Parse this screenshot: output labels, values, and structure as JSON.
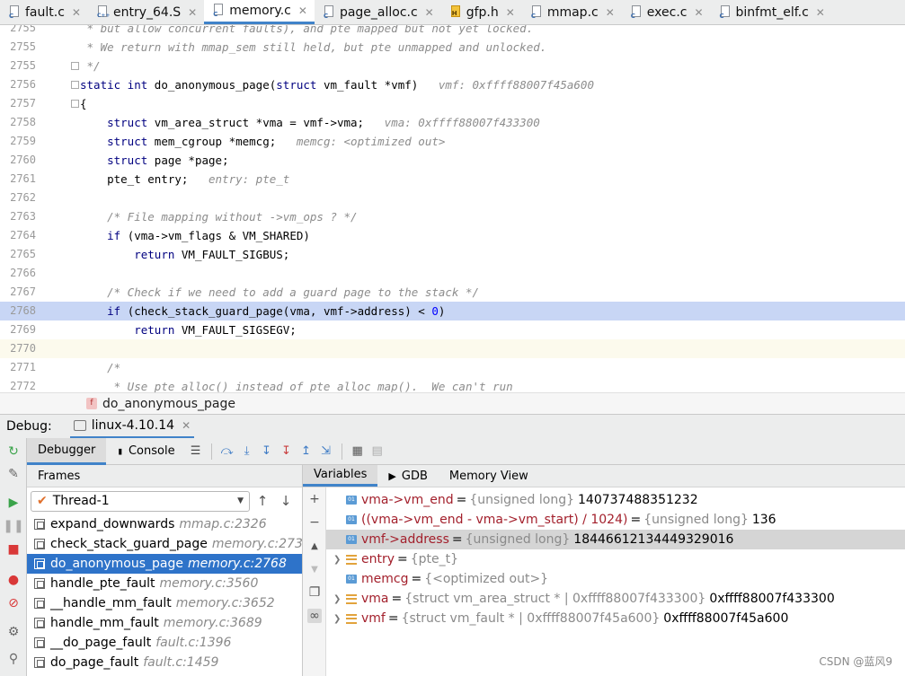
{
  "tabs": [
    {
      "label": "fault.c",
      "icon": "c-file-icon",
      "kind": "c"
    },
    {
      "label": "entry_64.S",
      "icon": "asm-file-icon",
      "kind": "cpp"
    },
    {
      "label": "memory.c",
      "icon": "c-file-icon",
      "kind": "c",
      "active": true
    },
    {
      "label": "page_alloc.c",
      "icon": "c-file-icon",
      "kind": "c"
    },
    {
      "label": "gfp.h",
      "icon": "header-file-icon",
      "kind": "h"
    },
    {
      "label": "mmap.c",
      "icon": "c-file-icon",
      "kind": "c"
    },
    {
      "label": "exec.c",
      "icon": "c-file-icon",
      "kind": "c"
    },
    {
      "label": "binfmt_elf.c",
      "icon": "c-file-icon",
      "kind": "c"
    }
  ],
  "tab_close_glyph": "✕",
  "editor": {
    "lines": [
      {
        "n": "2755",
        "parts": [
          [
            "cm",
            " * but allow concurrent faults), and pte mapped but not yet locked."
          ]
        ]
      },
      {
        "n": "2755",
        "parts": [
          [
            "cm",
            " * We return with mmap_sem still held, but pte unmapped and unlocked."
          ]
        ]
      },
      {
        "n": "2755",
        "parts": [
          [
            "cm",
            " */"
          ]
        ]
      },
      {
        "n": "2756",
        "parts": [
          [
            "kw",
            "static int"
          ],
          [
            "",
            " do_anonymous_page("
          ],
          [
            "kw",
            "struct"
          ],
          [
            "",
            " vm_fault *vmf)   "
          ],
          [
            "inl",
            "vmf: 0xffff88007f45a600"
          ]
        ]
      },
      {
        "n": "2757",
        "parts": [
          [
            "",
            "{"
          ]
        ]
      },
      {
        "n": "2758",
        "parts": [
          [
            "",
            "    "
          ],
          [
            "kw",
            "struct"
          ],
          [
            "",
            " vm_area_struct *vma = vmf->vma;   "
          ],
          [
            "inl",
            "vma: 0xffff88007f433300"
          ]
        ]
      },
      {
        "n": "2759",
        "parts": [
          [
            "",
            "    "
          ],
          [
            "kw",
            "struct"
          ],
          [
            "",
            " mem_cgroup *memcg;   "
          ],
          [
            "inl",
            "memcg: <optimized out>"
          ]
        ]
      },
      {
        "n": "2760",
        "parts": [
          [
            "",
            "    "
          ],
          [
            "kw",
            "struct"
          ],
          [
            "",
            " page *page;"
          ]
        ]
      },
      {
        "n": "2761",
        "parts": [
          [
            "",
            "    pte_t entry;   "
          ],
          [
            "inl",
            "entry: pte_t"
          ]
        ]
      },
      {
        "n": "2762",
        "parts": [
          [
            "",
            ""
          ]
        ]
      },
      {
        "n": "2763",
        "parts": [
          [
            "",
            "    "
          ],
          [
            "cm",
            "/* File mapping without ->vm_ops ? */"
          ]
        ]
      },
      {
        "n": "2764",
        "parts": [
          [
            "",
            "    "
          ],
          [
            "kw",
            "if"
          ],
          [
            "",
            " (vma->vm_flags & VM_SHARED)"
          ]
        ]
      },
      {
        "n": "2765",
        "parts": [
          [
            "",
            "        "
          ],
          [
            "kw",
            "return"
          ],
          [
            "",
            " VM_FAULT_SIGBUS;"
          ]
        ]
      },
      {
        "n": "2766",
        "parts": [
          [
            "",
            ""
          ]
        ]
      },
      {
        "n": "2767",
        "parts": [
          [
            "",
            "    "
          ],
          [
            "cm",
            "/* Check if we need to add a guard page to the stack */"
          ]
        ]
      },
      {
        "n": "2768",
        "hl": "exec",
        "parts": [
          [
            "",
            "    "
          ],
          [
            "kw",
            "if"
          ],
          [
            "",
            " (check_stack_guard_page(vma, vmf->address) < "
          ],
          [
            "num",
            "0"
          ],
          [
            "",
            ")"
          ]
        ]
      },
      {
        "n": "2769",
        "parts": [
          [
            "",
            "        "
          ],
          [
            "kw",
            "return"
          ],
          [
            "",
            " VM_FAULT_SIGSEGV;"
          ]
        ]
      },
      {
        "n": "2770",
        "hl": "caret",
        "parts": [
          [
            "",
            ""
          ]
        ]
      },
      {
        "n": "2771",
        "parts": [
          [
            "",
            "    "
          ],
          [
            "cm",
            "/*"
          ]
        ]
      },
      {
        "n": "2772",
        "parts": [
          [
            "cm",
            "     * Use pte_alloc() instead of pte_alloc_map().  We can't run"
          ]
        ]
      }
    ]
  },
  "breadcrumb": {
    "badge": "f",
    "label": "do_anonymous_page"
  },
  "debug": {
    "title": "Debug:",
    "session": "linux-4.10.14",
    "subtabs": [
      "Debugger",
      "Console"
    ],
    "toolbar_icons": [
      "show-execution-point-icon",
      "step-over-icon",
      "step-into-icon",
      "force-step-into-icon",
      "step-out-icon",
      "run-to-cursor-icon",
      "evaluate-icon",
      "table-view-icon"
    ],
    "frames_header": "Frames",
    "thread": "Thread-1",
    "frames": [
      {
        "fn": "expand_downwards",
        "loc": "mmap.c:2326"
      },
      {
        "fn": "check_stack_guard_page",
        "loc": "memory.c:2737"
      },
      {
        "fn": "do_anonymous_page",
        "loc": "memory.c:2768",
        "selected": true
      },
      {
        "fn": "handle_pte_fault",
        "loc": "memory.c:3560"
      },
      {
        "fn": "__handle_mm_fault",
        "loc": "memory.c:3652"
      },
      {
        "fn": "handle_mm_fault",
        "loc": "memory.c:3689"
      },
      {
        "fn": "__do_page_fault",
        "loc": "fault.c:1396"
      },
      {
        "fn": "do_page_fault",
        "loc": "fault.c:1459"
      }
    ],
    "var_tabs": [
      "Variables",
      "GDB",
      "Memory View"
    ],
    "variables": [
      {
        "kind": "watch",
        "expand": false,
        "name": "vma->vm_end",
        "type": "{unsigned long}",
        "value": "140737488351232"
      },
      {
        "kind": "watch",
        "expand": false,
        "name": "((vma->vm_end - vma->vm_start) / 1024)",
        "type": "{unsigned long}",
        "value": "136"
      },
      {
        "kind": "watch",
        "expand": false,
        "name": "vmf->address",
        "type": "{unsigned long}",
        "value": "18446612134449329016",
        "selected": true
      },
      {
        "kind": "struct",
        "expand": true,
        "name": "entry",
        "type": "{pte_t}",
        "value": ""
      },
      {
        "kind": "watch",
        "expand": false,
        "name": "memcg",
        "type": "{<optimized out>}",
        "value": ""
      },
      {
        "kind": "struct",
        "expand": true,
        "name": "vma",
        "type": "{struct vm_area_struct * | 0xffff88007f433300}",
        "value": "0xffff88007f433300"
      },
      {
        "kind": "struct",
        "expand": true,
        "name": "vmf",
        "type": "{struct vm_fault * | 0xffff88007f45a600}",
        "value": "0xffff88007f45a600"
      }
    ]
  },
  "watermark": "CSDN @蓝风9"
}
